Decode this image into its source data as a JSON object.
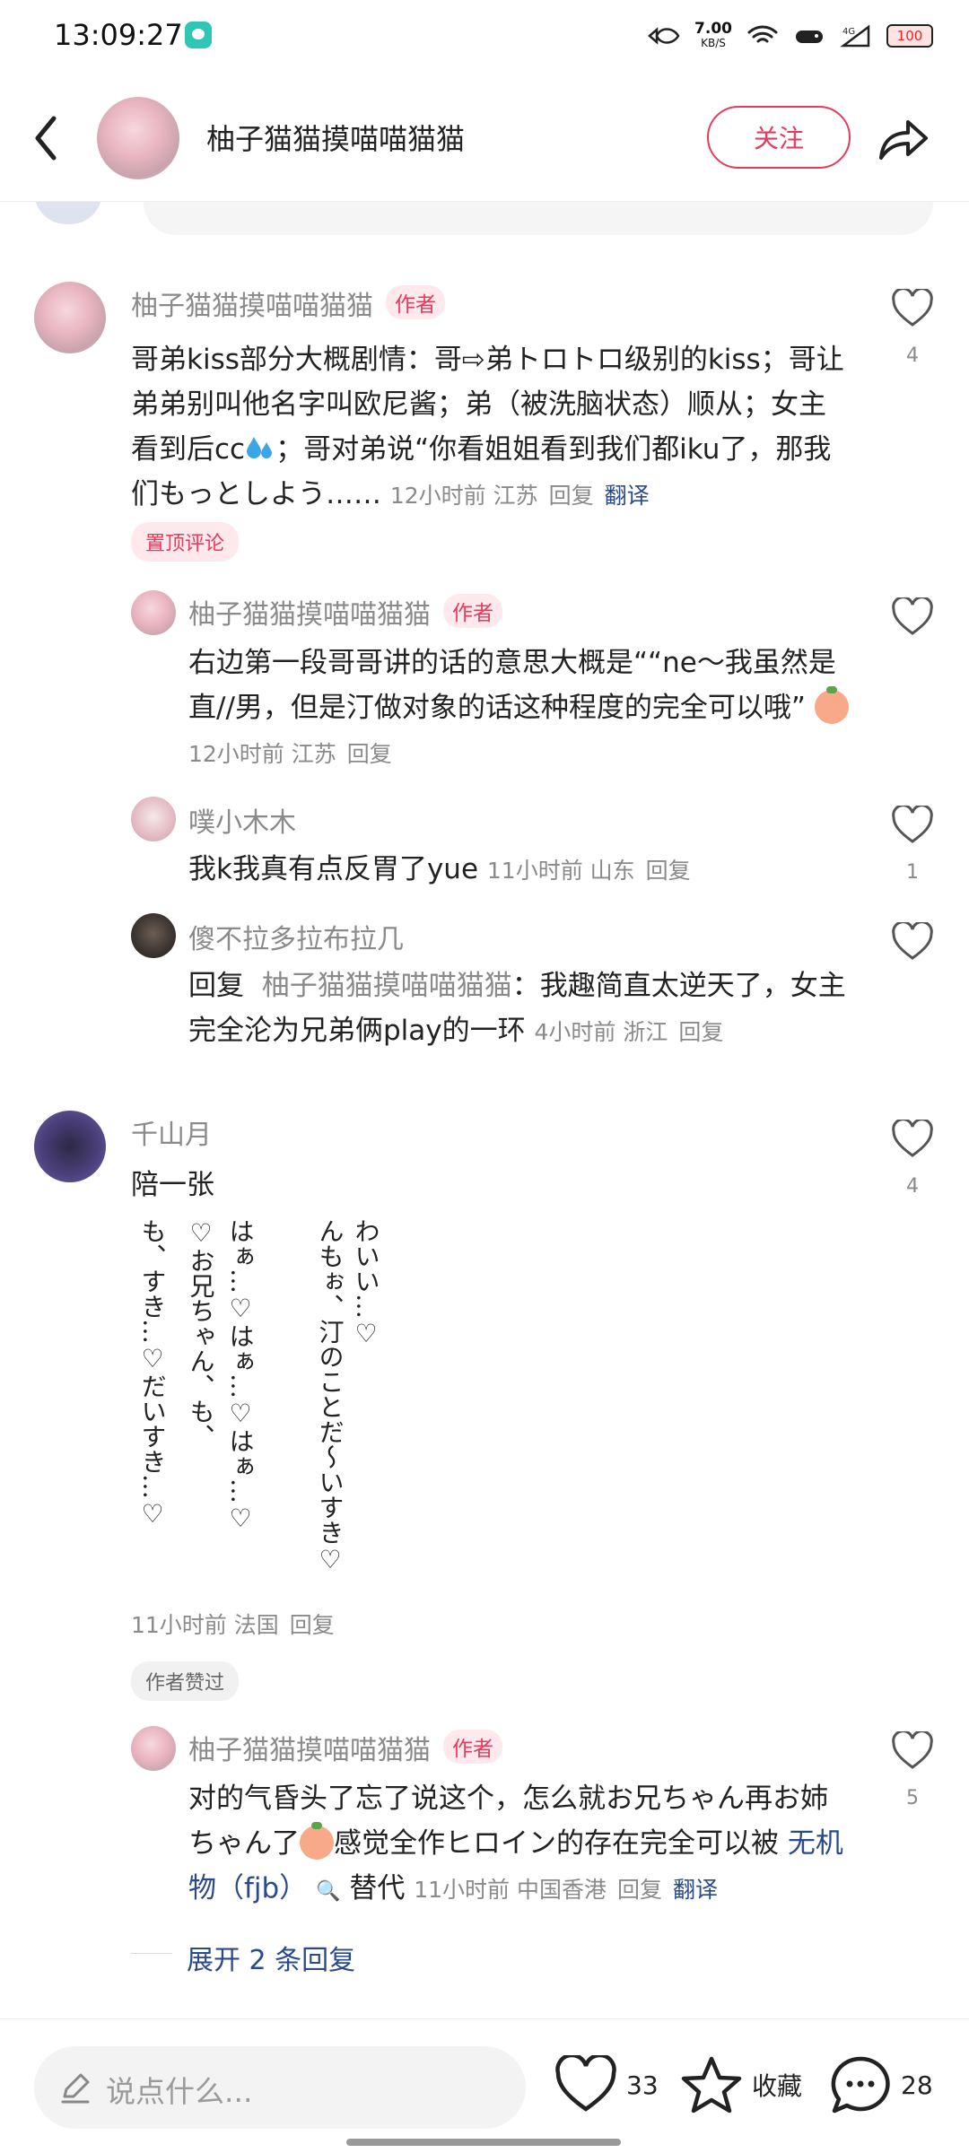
{
  "status_bar": {
    "time": "13:09:27",
    "net_speed_value": "7.00",
    "net_speed_unit": "KB/S",
    "battery": "100"
  },
  "header": {
    "title": "柚子猫猫摸喵喵猫猫",
    "follow_label": "关注"
  },
  "comments": [
    {
      "username": "柚子猫猫摸喵喵猫猫",
      "badge": "作者",
      "text_1": "哥弟kiss部分大概剧情：哥⇨弟トロトロ级别的kiss；哥让弟弟别叫他名字叫欧尼酱；弟（被洗脑状态）顺从；女主看到后cc",
      "text_2": "；哥对弟说“你看姐姐看到我们都iku了，那我们もっとしよう……",
      "time": "12小时前",
      "location": "江苏",
      "reply": "回复",
      "translate": "翻译",
      "tag": "置顶评论",
      "likes": "4"
    },
    {
      "username": "柚子猫猫摸喵喵猫猫",
      "badge": "作者",
      "text": "右边第一段哥哥讲的话的意思大概是““ne～我虽然是直//男，但是汀做对象的话这种程度的完全可以哦”",
      "time": "12小时前",
      "location": "江苏",
      "reply": "回复"
    },
    {
      "username": "噗小木木",
      "text": "我k我真有点反胃了yue",
      "time": "11小时前",
      "location": "山东",
      "reply": "回复",
      "likes": "1"
    },
    {
      "username": "傻不拉多拉布拉几",
      "reply_prefix": "回复",
      "reply_to": "柚子猫猫摸喵喵猫猫",
      "text": "：我趣简直太逆天了，女主完全沦为兄弟俩play的一环",
      "time": "4小时前",
      "location": "浙江",
      "reply": "回复"
    },
    {
      "username": "千山月",
      "text": "陪一张",
      "image_lines": [
        "わいい…♡",
        "んもぉ、汀のことだ～いすき♡",
        "はぁ…♡はぁ…♡はぁ…♡",
        "♡お兄ちゃん、も、",
        "も、すき…♡だいすき…♡"
      ],
      "time": "11小时前",
      "location": "法国",
      "reply": "回复",
      "tag": "作者赞过",
      "likes": "4"
    },
    {
      "username": "柚子猫猫摸喵喵猫猫",
      "badge": "作者",
      "text_1": "对的气昏头了忘了说这个，怎么就お兄ちゃん再お姉ちゃん了",
      "text_2": "感觉全作ヒロイン的存在完全可以被",
      "link": "无机物（fjb）",
      "search_icon": "🔍",
      "text_3": "替代",
      "time": "11小时前",
      "location": "中国香港",
      "reply": "回复",
      "translate": "翻译",
      "likes": "5"
    }
  ],
  "expand_replies": "展开 2 条回复",
  "bottom_bar": {
    "placeholder": "说点什么...",
    "likes": "33",
    "favorite_label": "收藏",
    "comments": "28"
  },
  "colors": {
    "accent": "#e83a5c",
    "link": "#2b4a8a",
    "meta_gray": "#8a8a8a"
  }
}
